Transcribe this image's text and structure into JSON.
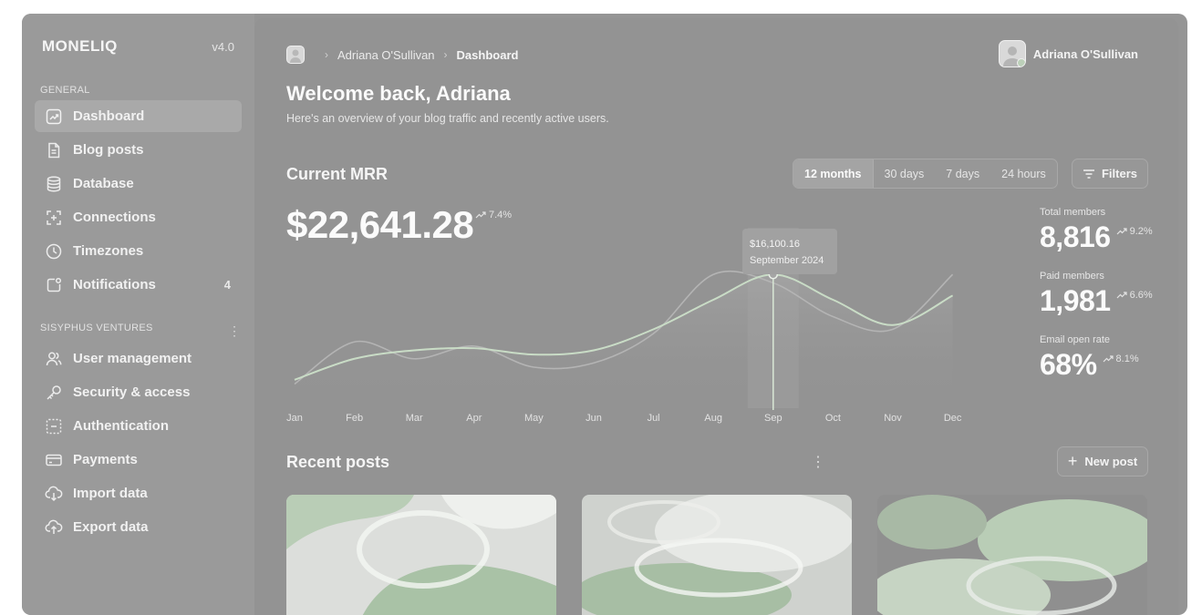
{
  "app": {
    "logo": "MONELIQ",
    "version": "v4.0"
  },
  "sidebar": {
    "general_label": "GENERAL",
    "general_items": [
      {
        "label": "Dashboard",
        "icon": "chart-icon",
        "active": true
      },
      {
        "label": "Blog posts",
        "icon": "document-icon"
      },
      {
        "label": "Database",
        "icon": "database-icon"
      },
      {
        "label": "Connections",
        "icon": "connections-icon"
      },
      {
        "label": "Timezones",
        "icon": "clock-icon"
      },
      {
        "label": "Notifications",
        "icon": "notification-icon",
        "badge": "4"
      }
    ],
    "workspace_label": "SISYPHUS VENTURES",
    "workspace_items": [
      {
        "label": "User management",
        "icon": "users-icon"
      },
      {
        "label": "Security & access",
        "icon": "key-icon"
      },
      {
        "label": "Authentication",
        "icon": "scan-icon"
      },
      {
        "label": "Payments",
        "icon": "credit-card-icon"
      },
      {
        "label": "Import data",
        "icon": "cloud-download-icon"
      },
      {
        "label": "Export data",
        "icon": "cloud-upload-icon"
      }
    ]
  },
  "header": {
    "breadcrumb": [
      "Adriana O'Sullivan",
      "Dashboard"
    ],
    "user_name": "Adriana O'Sullivan"
  },
  "welcome": {
    "title": "Welcome back, Adriana",
    "subtitle": "Here's an overview of your blog traffic and recently active users."
  },
  "mrr": {
    "title": "Current MRR",
    "value": "$22,641.28",
    "delta": "7.4%",
    "ranges": [
      "12 months",
      "30 days",
      "7 days",
      "24 hours"
    ],
    "active_range": "12 months",
    "filters_label": "Filters",
    "tooltip_value": "$16,100.16",
    "tooltip_date": "September 2024"
  },
  "stats": [
    {
      "label": "Total members",
      "value": "8,816",
      "delta": "9.2%"
    },
    {
      "label": "Paid members",
      "value": "1,981",
      "delta": "6.6%"
    },
    {
      "label": "Email open rate",
      "value": "68%",
      "delta": "8.1%"
    }
  ],
  "chart_data": {
    "type": "line",
    "x": [
      "Jan",
      "Feb",
      "Mar",
      "Apr",
      "May",
      "Jun",
      "Jul",
      "Aug",
      "Sep",
      "Oct",
      "Nov",
      "Dec"
    ],
    "series": [
      {
        "values": [
          5,
          10,
          12,
          12.5,
          11,
          12,
          17,
          24,
          30,
          24,
          18,
          25
        ],
        "style": "primary"
      },
      {
        "values": [
          4,
          14,
          10,
          13,
          8,
          9,
          16,
          30,
          28,
          20,
          17,
          30
        ],
        "style": "secondary"
      }
    ],
    "ylim": [
      0,
      40
    ],
    "highlight_index": 8,
    "colors": {
      "primary": "#c9dcc6",
      "secondary": "#b4b4b4"
    }
  },
  "posts": {
    "title": "Recent posts",
    "new_label": "New post"
  },
  "colors": {
    "accent_green": "#c9dcc6",
    "panel": "#939393",
    "sidebar": "#9a9a9a"
  }
}
